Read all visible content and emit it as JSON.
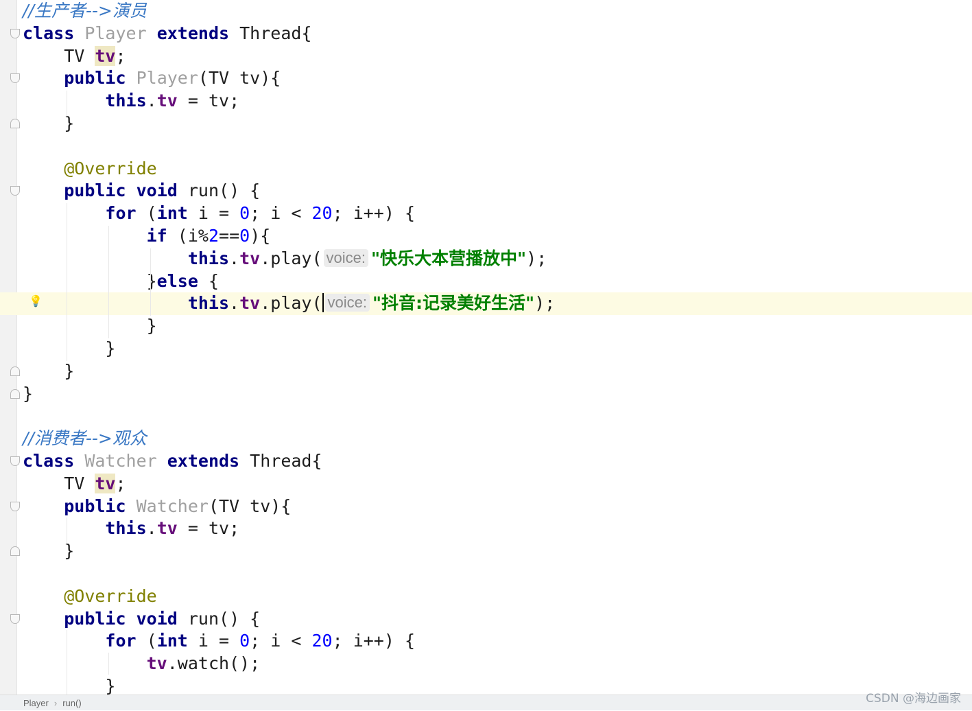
{
  "editor": {
    "lines": [
      {
        "tokens": [
          {
            "t": "//生产者-->演员",
            "c": "cmt"
          }
        ]
      },
      {
        "tokens": [
          {
            "t": "class",
            "c": "kw"
          },
          {
            "t": " "
          },
          {
            "t": "Player",
            "c": "cls"
          },
          {
            "t": " "
          },
          {
            "t": "extends",
            "c": "kw"
          },
          {
            "t": " Thread{"
          }
        ]
      },
      {
        "tokens": [
          {
            "t": "    TV "
          },
          {
            "t": "tv",
            "c": "fld-hl"
          },
          {
            "t": ";"
          }
        ]
      },
      {
        "tokens": [
          {
            "t": "    "
          },
          {
            "t": "public",
            "c": "kw"
          },
          {
            "t": " "
          },
          {
            "t": "Player",
            "c": "cls"
          },
          {
            "t": "(TV tv){"
          }
        ]
      },
      {
        "tokens": [
          {
            "t": "        "
          },
          {
            "t": "this",
            "c": "kw"
          },
          {
            "t": "."
          },
          {
            "t": "tv",
            "c": "fld"
          },
          {
            "t": " = tv;"
          }
        ]
      },
      {
        "tokens": [
          {
            "t": "    }"
          }
        ]
      },
      {
        "tokens": []
      },
      {
        "tokens": [
          {
            "t": "    "
          },
          {
            "t": "@Override",
            "c": "ann"
          }
        ]
      },
      {
        "tokens": [
          {
            "t": "    "
          },
          {
            "t": "public",
            "c": "kw"
          },
          {
            "t": " "
          },
          {
            "t": "void",
            "c": "kw"
          },
          {
            "t": " run() {"
          }
        ]
      },
      {
        "tokens": [
          {
            "t": "        "
          },
          {
            "t": "for",
            "c": "kw"
          },
          {
            "t": " ("
          },
          {
            "t": "int",
            "c": "kw"
          },
          {
            "t": " i = "
          },
          {
            "t": "0",
            "c": "num"
          },
          {
            "t": "; i < "
          },
          {
            "t": "20",
            "c": "num"
          },
          {
            "t": "; i++) {"
          }
        ]
      },
      {
        "tokens": [
          {
            "t": "            "
          },
          {
            "t": "if",
            "c": "kw"
          },
          {
            "t": " (i%"
          },
          {
            "t": "2",
            "c": "num"
          },
          {
            "t": "=="
          },
          {
            "t": "0",
            "c": "num"
          },
          {
            "t": "){"
          }
        ]
      },
      {
        "tokens": [
          {
            "t": "                "
          },
          {
            "t": "this",
            "c": "kw"
          },
          {
            "t": "."
          },
          {
            "t": "tv",
            "c": "fld"
          },
          {
            "t": ".play("
          },
          {
            "t": "voice:",
            "c": "hint"
          },
          {
            "t": "\"快乐大本营播放中\"",
            "c": "str"
          },
          {
            "t": ");"
          }
        ]
      },
      {
        "tokens": [
          {
            "t": "            }"
          },
          {
            "t": "else",
            "c": "kw"
          },
          {
            "t": " {"
          }
        ]
      },
      {
        "tokens": [
          {
            "t": "                "
          },
          {
            "t": "this",
            "c": "kw"
          },
          {
            "t": "."
          },
          {
            "t": "tv",
            "c": "fld"
          },
          {
            "t": ".play("
          },
          {
            "t": "",
            "c": "caret"
          },
          {
            "t": "voice:",
            "c": "hint"
          },
          {
            "t": "\"抖音:记录美好生活\"",
            "c": "str"
          },
          {
            "t": ");"
          }
        ],
        "current": true
      },
      {
        "tokens": [
          {
            "t": "            }"
          }
        ]
      },
      {
        "tokens": [
          {
            "t": "        }"
          }
        ]
      },
      {
        "tokens": [
          {
            "t": "    }"
          }
        ]
      },
      {
        "tokens": [
          {
            "t": "}"
          }
        ]
      },
      {
        "tokens": []
      },
      {
        "tokens": [
          {
            "t": "//消费者-->观众",
            "c": "cmt"
          }
        ]
      },
      {
        "tokens": [
          {
            "t": "class",
            "c": "kw"
          },
          {
            "t": " "
          },
          {
            "t": "Watcher",
            "c": "cls"
          },
          {
            "t": " "
          },
          {
            "t": "extends",
            "c": "kw"
          },
          {
            "t": " Thread{"
          }
        ]
      },
      {
        "tokens": [
          {
            "t": "    TV "
          },
          {
            "t": "tv",
            "c": "fld-hl"
          },
          {
            "t": ";"
          }
        ]
      },
      {
        "tokens": [
          {
            "t": "    "
          },
          {
            "t": "public",
            "c": "kw"
          },
          {
            "t": " "
          },
          {
            "t": "Watcher",
            "c": "cls"
          },
          {
            "t": "(TV tv){"
          }
        ]
      },
      {
        "tokens": [
          {
            "t": "        "
          },
          {
            "t": "this",
            "c": "kw"
          },
          {
            "t": "."
          },
          {
            "t": "tv",
            "c": "fld"
          },
          {
            "t": " = tv;"
          }
        ]
      },
      {
        "tokens": [
          {
            "t": "    }"
          }
        ]
      },
      {
        "tokens": []
      },
      {
        "tokens": [
          {
            "t": "    "
          },
          {
            "t": "@Override",
            "c": "ann"
          }
        ]
      },
      {
        "tokens": [
          {
            "t": "    "
          },
          {
            "t": "public",
            "c": "kw"
          },
          {
            "t": " "
          },
          {
            "t": "void",
            "c": "kw"
          },
          {
            "t": " run() {"
          }
        ]
      },
      {
        "tokens": [
          {
            "t": "        "
          },
          {
            "t": "for",
            "c": "kw"
          },
          {
            "t": " ("
          },
          {
            "t": "int",
            "c": "kw"
          },
          {
            "t": " i = "
          },
          {
            "t": "0",
            "c": "num"
          },
          {
            "t": "; i < "
          },
          {
            "t": "20",
            "c": "num"
          },
          {
            "t": "; i++) {"
          }
        ]
      },
      {
        "tokens": [
          {
            "t": "            "
          },
          {
            "t": "tv",
            "c": "fld"
          },
          {
            "t": ".watch();"
          }
        ]
      },
      {
        "tokens": [
          {
            "t": "        }"
          }
        ]
      }
    ],
    "folds": [
      {
        "line": 1,
        "kind": "open"
      },
      {
        "line": 3,
        "kind": "open"
      },
      {
        "line": 5,
        "kind": "close"
      },
      {
        "line": 8,
        "kind": "open"
      },
      {
        "line": 16,
        "kind": "close"
      },
      {
        "line": 17,
        "kind": "close"
      },
      {
        "line": 20,
        "kind": "open"
      },
      {
        "line": 22,
        "kind": "open"
      },
      {
        "line": 24,
        "kind": "close"
      },
      {
        "line": 27,
        "kind": "open"
      }
    ],
    "intention_icon": "lightbulb-icon"
  },
  "statusbar": {
    "breadcrumb": [
      "Player",
      "run()"
    ]
  },
  "watermark": "CSDN @海边画家"
}
